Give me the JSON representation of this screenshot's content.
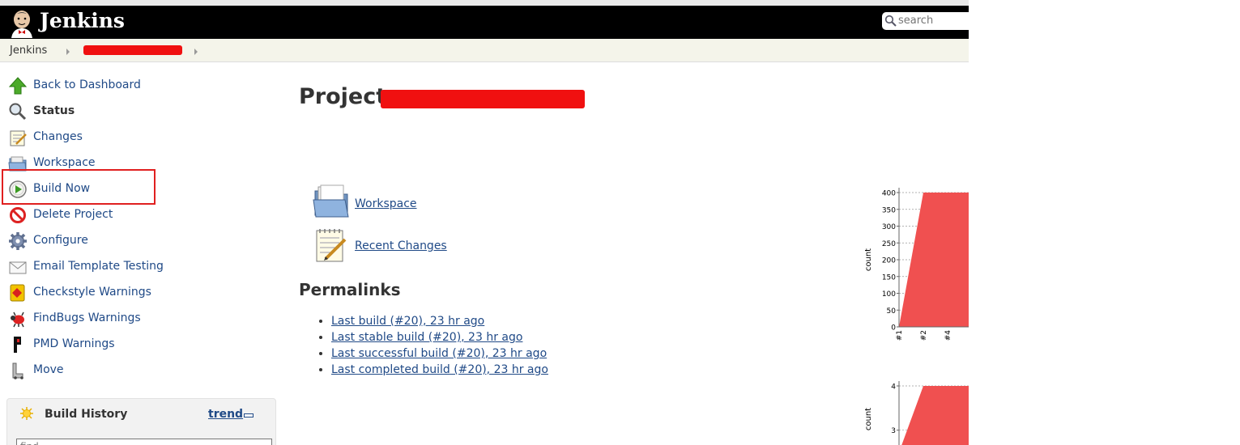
{
  "header": {
    "brand": "Jenkins",
    "search_placeholder": "search"
  },
  "breadcrumb": {
    "home": "Jenkins"
  },
  "tasks": [
    {
      "label": "Back to Dashboard",
      "icon": "up-arrow-icon"
    },
    {
      "label": "Status",
      "icon": "search-status-icon"
    },
    {
      "label": "Changes",
      "icon": "notepad-icon"
    },
    {
      "label": "Workspace",
      "icon": "folder-icon"
    },
    {
      "label": "Build Now",
      "icon": "clock-play-icon"
    },
    {
      "label": "Delete Project",
      "icon": "no-entry-icon"
    },
    {
      "label": "Configure",
      "icon": "gear-icon"
    },
    {
      "label": "Email Template Testing",
      "icon": "envelope-icon"
    },
    {
      "label": "Checkstyle Warnings",
      "icon": "checkstyle-icon"
    },
    {
      "label": "FindBugs Warnings",
      "icon": "bug-icon"
    },
    {
      "label": "PMD Warnings",
      "icon": "pmd-icon"
    },
    {
      "label": "Move",
      "icon": "move-icon"
    }
  ],
  "build_history": {
    "title": "Build History",
    "trend": "trend",
    "filter_placeholder": "find"
  },
  "main": {
    "title_prefix": "Project",
    "links": [
      {
        "label": "Workspace"
      },
      {
        "label": "Recent Changes"
      }
    ],
    "permalinks_heading": "Permalinks",
    "permalinks": [
      "Last build (#20), 23 hr ago",
      "Last stable build (#20), 23 hr ago",
      "Last successful build (#20), 23 hr ago",
      "Last completed build (#20), 23 hr ago"
    ]
  },
  "colors": {
    "link": "#204a87",
    "header_bg": "#000000",
    "highlight": "#e02020",
    "chart_fill": "#f05050"
  },
  "chart_data": [
    {
      "type": "area",
      "ylabel": "count",
      "yticks": [
        0,
        50,
        100,
        150,
        200,
        250,
        300,
        350,
        400
      ],
      "ylim": [
        0,
        400
      ],
      "categories": [
        "#1",
        "#2",
        "#4"
      ],
      "series": [
        {
          "values": [
            0,
            400,
            400
          ]
        }
      ],
      "grid": true
    },
    {
      "type": "area",
      "ylabel": "count",
      "yticks": [
        3,
        4
      ],
      "ylim": [
        2.5,
        4
      ],
      "series": [
        {
          "values": [
            2.5,
            4,
            4
          ]
        }
      ],
      "grid": true
    }
  ]
}
